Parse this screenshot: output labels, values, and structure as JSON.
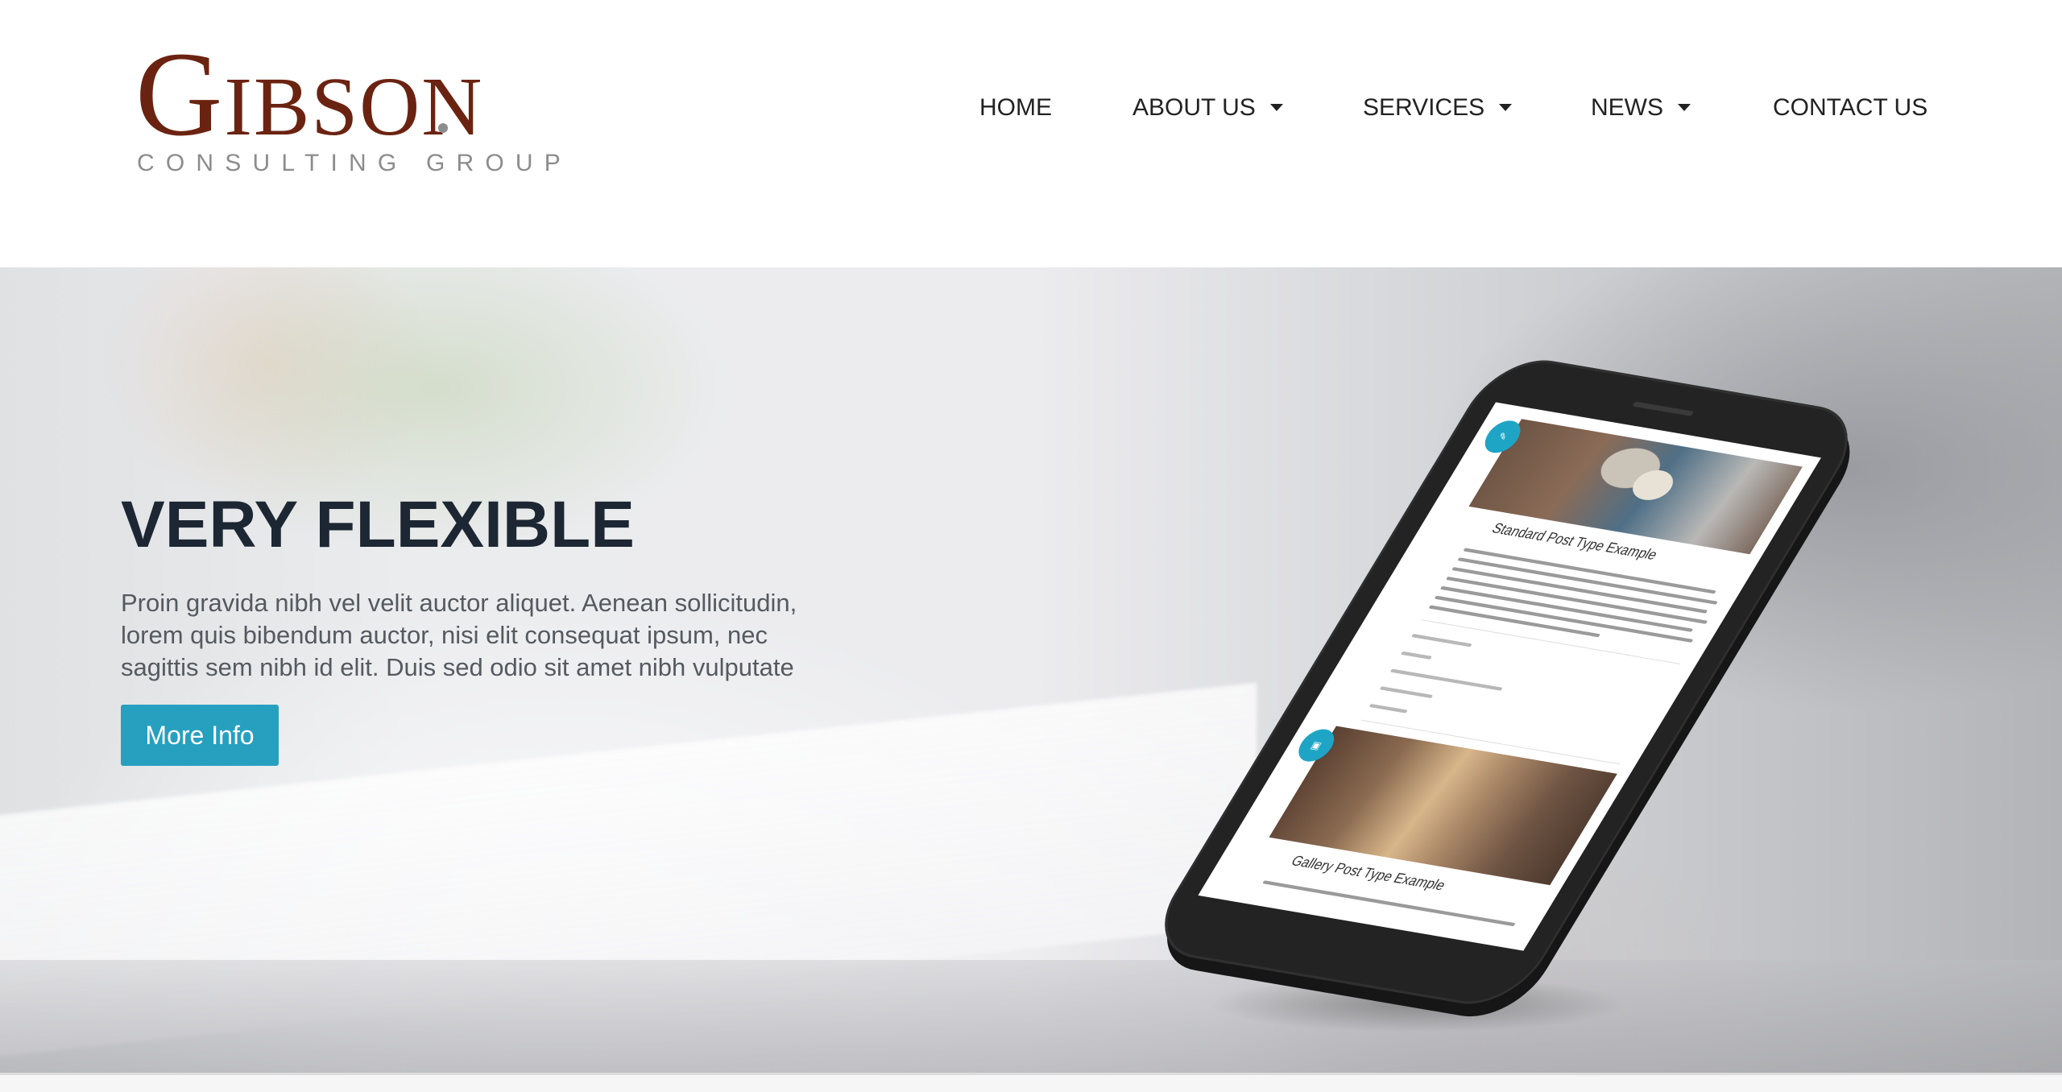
{
  "brand": {
    "logo_word_1": "G",
    "logo_word_2": "IBS",
    "logo_word_3": "O",
    "logo_word_4": "N",
    "logo_subtitle": "CONSULTING GROUP",
    "primary_color": "#6b2311"
  },
  "nav": {
    "items": [
      {
        "label": "HOME",
        "has_dropdown": false
      },
      {
        "label": "ABOUT US",
        "has_dropdown": true
      },
      {
        "label": "SERVICES",
        "has_dropdown": true
      },
      {
        "label": "NEWS",
        "has_dropdown": true
      },
      {
        "label": "CONTACT US",
        "has_dropdown": false
      }
    ],
    "dropdown_icon": "caret-down-icon"
  },
  "hero": {
    "title": "VERY FLEXIBLE",
    "text_lines": [
      "Proin gravida nibh vel velit auctor aliquet. Aenean sollicitudin,",
      "lorem quis bibendum auctor, nisi elit consequat ipsum, nec",
      "sagittis sem nibh id elit. Duis sed odio sit amet nibh vulputate"
    ],
    "button_label": "More Info",
    "button_color": "#27a0c0"
  },
  "phone": {
    "post_1_title": "Standard Post Type Example",
    "post_2_title": "Gallery Post Type Example",
    "badge_color": "#1ea5c6"
  }
}
